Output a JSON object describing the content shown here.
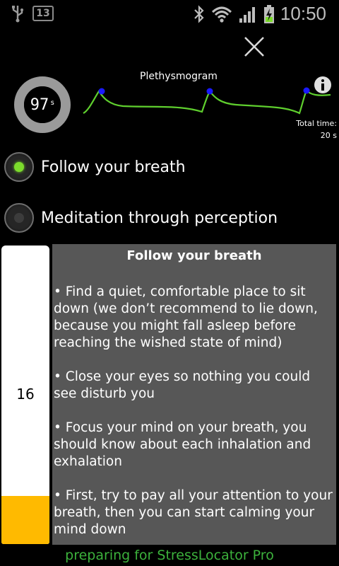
{
  "status_bar": {
    "notification_count": "13",
    "time": "10:50"
  },
  "timer": {
    "value": "97",
    "unit": "s"
  },
  "plethysmogram": {
    "title": "Plethysmogram",
    "total_time_label": "Total time:",
    "total_time_value": "20 s"
  },
  "options": [
    {
      "label": "Follow your breath",
      "selected": true
    },
    {
      "label": "Meditation through perception",
      "selected": false
    }
  ],
  "gauge": {
    "value": "16",
    "fill_fraction": 0.16,
    "fill_color": "#ffba00"
  },
  "panel": {
    "title": "Follow your breath",
    "paragraphs": [
      "• Find a quiet, comfortable place to sit down (we don’t recommend to lie down, because you might fall asleep before reaching the wished state of mind)",
      "• Close your eyes so nothing you could see disturb you",
      "• Focus your mind on your breath, you should know about each inhalation and exhalation",
      "• First, try to pay all your attention to your breath, then you can start calming your mind down"
    ]
  },
  "footer": "preparing for StressLocator Pro",
  "colors": {
    "accent_green": "#7cdc2c",
    "wave_green": "#5fcf2e",
    "peak_blue": "#1a1aff",
    "panel_gray": "#575757"
  },
  "icons": [
    "usb-icon",
    "bluetooth-icon",
    "wifi-icon",
    "signal-icon",
    "battery-charging-icon",
    "close-icon",
    "info-icon"
  ]
}
